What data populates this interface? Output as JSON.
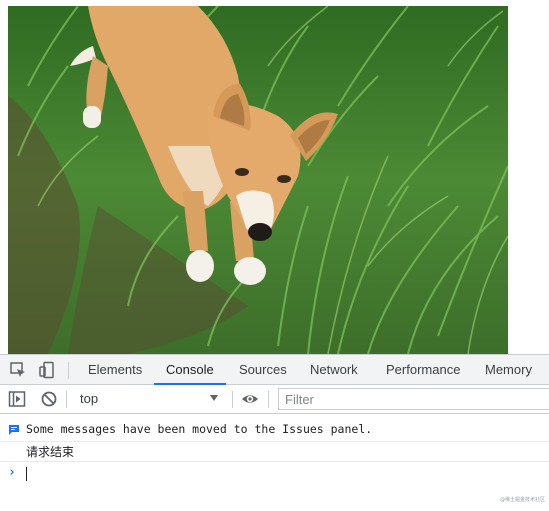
{
  "page": {
    "image_alt": "Dog standing on grass"
  },
  "devtools": {
    "tabs": [
      {
        "label": "Elements",
        "active": false
      },
      {
        "label": "Console",
        "active": true
      },
      {
        "label": "Sources",
        "active": false
      },
      {
        "label": "Network",
        "active": false
      },
      {
        "label": "Performance",
        "active": false
      },
      {
        "label": "Memory",
        "active": false
      }
    ],
    "toolbar": {
      "context": "top",
      "filter_placeholder": "Filter"
    },
    "console": {
      "issues_message": "Some messages have been moved to the Issues panel.",
      "log_message": "请求结束",
      "prompt": "›"
    },
    "watermark": "@稀土掘金技术社区"
  },
  "colors": {
    "accent": "#1a73e8",
    "toolbar_bg": "#f1f3f4",
    "border": "#cacdd1"
  },
  "icons": [
    "inspect-element-icon",
    "device-toolbar-icon",
    "sidebar-toggle-icon",
    "clear-console-icon",
    "eye-icon",
    "info-flag-icon"
  ]
}
